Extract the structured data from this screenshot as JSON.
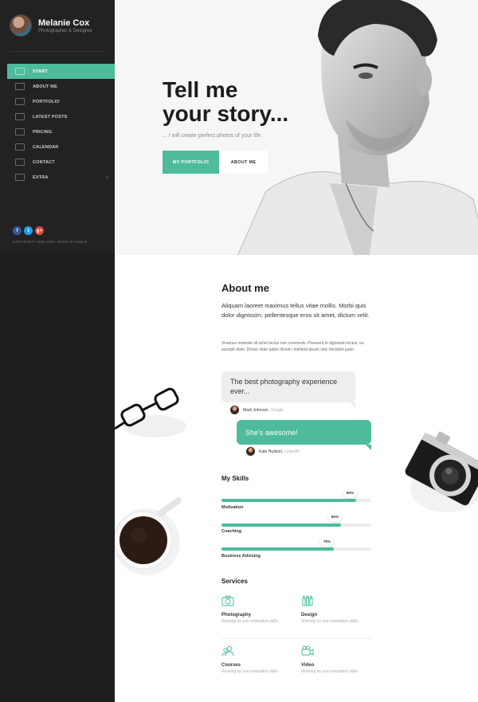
{
  "profile": {
    "name": "Melanie Cox",
    "role": "Photographer & Designer"
  },
  "nav": [
    {
      "label": "START",
      "icon": "home-icon",
      "active": true
    },
    {
      "label": "ABOUT ME",
      "icon": "chat-icon"
    },
    {
      "label": "PORTFOLIO",
      "icon": "monitor-icon"
    },
    {
      "label": "LATEST POSTS",
      "icon": "pen-icon"
    },
    {
      "label": "PRICING",
      "icon": "tag-icon"
    },
    {
      "label": "CALENDAR",
      "icon": "calendar-icon"
    },
    {
      "label": "CONTACT",
      "icon": "envelope-icon"
    },
    {
      "label": "EXTRA",
      "icon": "heart-icon",
      "chevron": "›"
    }
  ],
  "socials": [
    {
      "label": "f",
      "color": "#3b5998",
      "icon": "facebook-icon"
    },
    {
      "label": "t",
      "color": "#1da1f2",
      "icon": "twitter-icon"
    },
    {
      "label": "g+",
      "color": "#dd4b39",
      "icon": "google-plus-icon"
    }
  ],
  "copyright": "COPYRIGHT 1991-2084. MADE BY SIBLO.",
  "hero": {
    "title_line1": "Tell me",
    "title_line2": "your story...",
    "subtitle": "... I will create perfect photos of your life",
    "primary_button": "MY PORTFOLIO",
    "secondary_button": "ABOUT ME"
  },
  "about": {
    "title": "About me",
    "lead": "Aliquam laoreet maximus tellus vitae mollis. Morbi quis dolor dignissim, pellentesque eros sit amet, dictum velit.",
    "small": "Vivamus molestie sit amet lectus non commodo. Praesent in dignissim lectus, eu suscipit diam. Donec vitae turpis dictum, eleifend ipsum sed, tincidunt justo."
  },
  "testimonials": [
    {
      "quote": "The best photography experience ever...",
      "author": "Mark Johnson,",
      "org": "Google"
    },
    {
      "quote": "She's awesome!",
      "author": "Kate Hudson,",
      "org": "LinkedIn"
    }
  ],
  "skills": {
    "title": "My Skills",
    "items": [
      {
        "label": "Motivation",
        "percent_label": "90%",
        "value": 0.9
      },
      {
        "label": "Coaching",
        "percent_label": "80%",
        "value": 0.8
      },
      {
        "label": "Business Advising",
        "percent_label": "75%",
        "value": 0.75
      }
    ]
  },
  "services": {
    "title": "Services",
    "items": [
      {
        "name": "Photography",
        "desc": "Working on you motivation skills",
        "icon": "camera-icon"
      },
      {
        "name": "Design",
        "desc": "Working on you motivation skills",
        "icon": "pencils-icon"
      },
      {
        "name": "Courses",
        "desc": "Working on you motivation skills",
        "icon": "people-icon"
      },
      {
        "name": "Video",
        "desc": "Working on you motivation skills",
        "icon": "video-camera-icon"
      }
    ]
  },
  "colors": {
    "accent": "#4dbb9c",
    "sidebar": "#1e1e1e"
  }
}
